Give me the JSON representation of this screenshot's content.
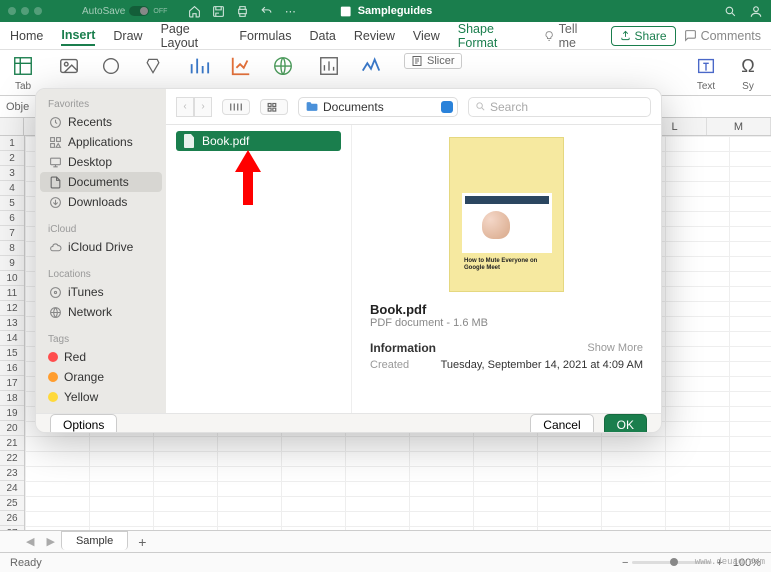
{
  "titlebar": {
    "autosave": "AutoSave",
    "autosave_state": "OFF",
    "doc_title": "Sampleguides"
  },
  "ribbon": {
    "tabs": [
      "Home",
      "Insert",
      "Draw",
      "Page Layout",
      "Formulas",
      "Data",
      "Review",
      "View",
      "Shape Format"
    ],
    "tellme": "Tell me",
    "share": "Share",
    "comments": "Comments",
    "icon_labels": {
      "tab": "Tab",
      "text": "Text",
      "sy": "Sy"
    },
    "slicer": "Slicer"
  },
  "namebox": "Obje",
  "columns_visible": [
    "L",
    "M"
  ],
  "dialog": {
    "sidebar": {
      "favorites_head": "Favorites",
      "favorites": [
        "Recents",
        "Applications",
        "Desktop",
        "Documents",
        "Downloads"
      ],
      "icloud_head": "iCloud",
      "icloud": [
        "iCloud Drive"
      ],
      "locations_head": "Locations",
      "locations": [
        "iTunes",
        "Network"
      ],
      "tags_head": "Tags",
      "tags": [
        {
          "label": "Red",
          "color": "#ff4d4d"
        },
        {
          "label": "Orange",
          "color": "#ff9d2e"
        },
        {
          "label": "Yellow",
          "color": "#ffd93b"
        }
      ]
    },
    "toolbar": {
      "path_label": "Documents",
      "search_placeholder": "Search"
    },
    "file_list": [
      {
        "name": "Book.pdf",
        "selected": true
      }
    ],
    "preview": {
      "thumb_caption": "How to Mute Everyone on Google Meet",
      "title": "Book.pdf",
      "subtitle": "PDF document - 1.6 MB",
      "info_head": "Information",
      "show_more": "Show More",
      "created_k": "Created",
      "created_v": "Tuesday, September 14, 2021 at 4:09 AM"
    },
    "footer": {
      "options": "Options",
      "cancel": "Cancel",
      "ok": "OK"
    }
  },
  "sheet": {
    "tab": "Sample"
  },
  "status": {
    "ready": "Ready",
    "zoom": "100%"
  },
  "watermark": "www.deuaq.com"
}
